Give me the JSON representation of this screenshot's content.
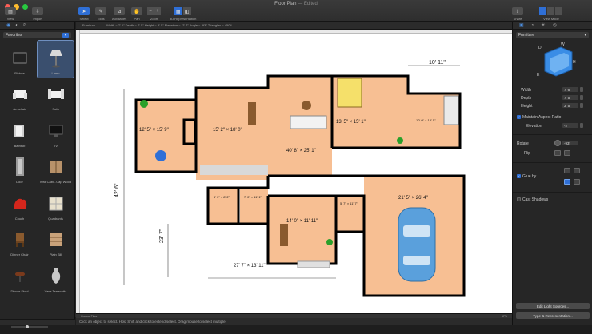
{
  "window": {
    "title": "Floor Plan",
    "edited": "— Edited"
  },
  "toolbar": {
    "left": [
      {
        "label": "View"
      },
      {
        "label": "Import"
      }
    ],
    "center": [
      {
        "label": "Select"
      },
      {
        "label": "Tools"
      },
      {
        "label": "Auxiliaries"
      },
      {
        "label": "Pan"
      },
      {
        "label": "Zoom"
      },
      {
        "label": "3D Representation"
      }
    ],
    "right": [
      {
        "label": "Share"
      },
      {
        "label": "View Mode"
      }
    ]
  },
  "library": {
    "category": "Favorites",
    "items": [
      {
        "label": "Picture"
      },
      {
        "label": "Lamp"
      },
      {
        "label": "Armchair"
      },
      {
        "label": "Sofa"
      },
      {
        "label": "Bathtub"
      },
      {
        "label": "TV"
      },
      {
        "label": "Door"
      },
      {
        "label": "Wall Cabi...Cap Wood"
      },
      {
        "label": "Couch"
      },
      {
        "label": "Quadrants"
      },
      {
        "label": "Dinner Chair"
      },
      {
        "label": "Plain Sill"
      },
      {
        "label": "Dinner Stool"
      },
      {
        "label": "Vase Terracotta"
      }
    ]
  },
  "canvas_info": "Width = 7' 6\"   Depth = 7' 5\"   Height = 3' 5\"   Elevation = -2' 7\"   Angle = -93°   Triangles = 4504",
  "canvas_layer": "Furniture",
  "floorplan": {
    "labels": [
      "10' 11\"",
      "12' 5\" × 15' 9\"",
      "15' 2\" × 18' 0\"",
      "40' 8\" × 25' 1\"",
      "13' 5\" × 15' 1\"",
      "10' 0\" × 13' 5\"",
      "42' 6\"",
      "5' 0\" × 8' 2\"",
      "7' 0\" × 11' 1\"",
      "14' 0\" × 11' 11\"",
      "5' 7\" × 11' 7\"",
      "21' 5\" × 26' 4\"",
      "23' 7\"",
      "27' 7\" × 13' 11\""
    ]
  },
  "status": {
    "level": "Ground Floor",
    "zoom": "67%",
    "hint": "Click an object to select. Hold Shift and click to extend select. Drag mouse to select multiple."
  },
  "inspector": {
    "tabs": [
      "furniture",
      "materials",
      "lighting",
      "camera"
    ],
    "category": "Furniture",
    "object": "Armchair",
    "props": [
      {
        "label": "Width",
        "value": "7' 6\""
      },
      {
        "label": "Depth",
        "value": "7' 5\""
      },
      {
        "label": "Height",
        "value": "3' 5\""
      }
    ],
    "maintain_aspect": "Maintain Aspect Ratio",
    "elevation": {
      "label": "Elevation",
      "value": "-2' 7\""
    },
    "rotate": {
      "label": "Rotate",
      "value": "-93°"
    },
    "flip": "Flip",
    "glue_by": "Glue by",
    "cast_shadows": "Cast Shadows",
    "buttons": [
      "Edit Light Sources...",
      "Type & Representation..."
    ]
  },
  "colors": {
    "accent": "#2f6fd6",
    "room_fill": "#f7bf93",
    "wall": "#000000",
    "car": "#5aa0dc"
  }
}
